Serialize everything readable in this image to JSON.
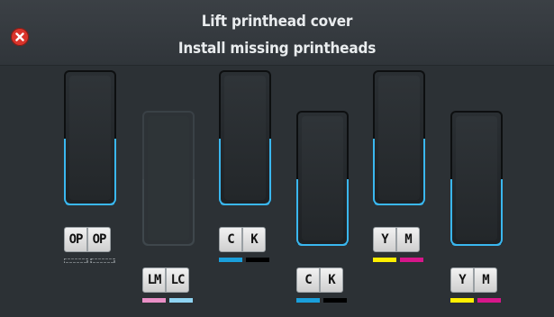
{
  "header": {
    "line1": "Lift printhead cover",
    "line2": "Install missing printheads"
  },
  "colors": {
    "background": "#2c3135",
    "slot_edge_blue": "#3ab7ef",
    "close_red": "#d9342b",
    "ink_cyan": "#1a9fdb",
    "ink_black": "#000000",
    "ink_yellow": "#ffef00",
    "ink_magenta": "#d6168a",
    "ink_light_magenta": "#e98fc6",
    "ink_light_cyan": "#8fd4f2",
    "ink_optimizer": "#b9c0c4"
  },
  "printheads": [
    {
      "labels": [
        "OP",
        "OP"
      ],
      "installed": true,
      "inks": [
        "optimizer",
        "optimizer"
      ]
    },
    {
      "labels": [
        "LM",
        "LC"
      ],
      "installed": false,
      "inks": [
        "light-magenta",
        "light-cyan"
      ]
    },
    {
      "labels": [
        "C",
        "K"
      ],
      "installed": true,
      "inks": [
        "cyan",
        "black"
      ]
    },
    {
      "labels": [
        "C",
        "K"
      ],
      "installed": true,
      "inks": [
        "cyan",
        "black"
      ]
    },
    {
      "labels": [
        "Y",
        "M"
      ],
      "installed": true,
      "inks": [
        "yellow",
        "magenta"
      ]
    },
    {
      "labels": [
        "Y",
        "M"
      ],
      "installed": true,
      "inks": [
        "yellow",
        "magenta"
      ]
    }
  ]
}
